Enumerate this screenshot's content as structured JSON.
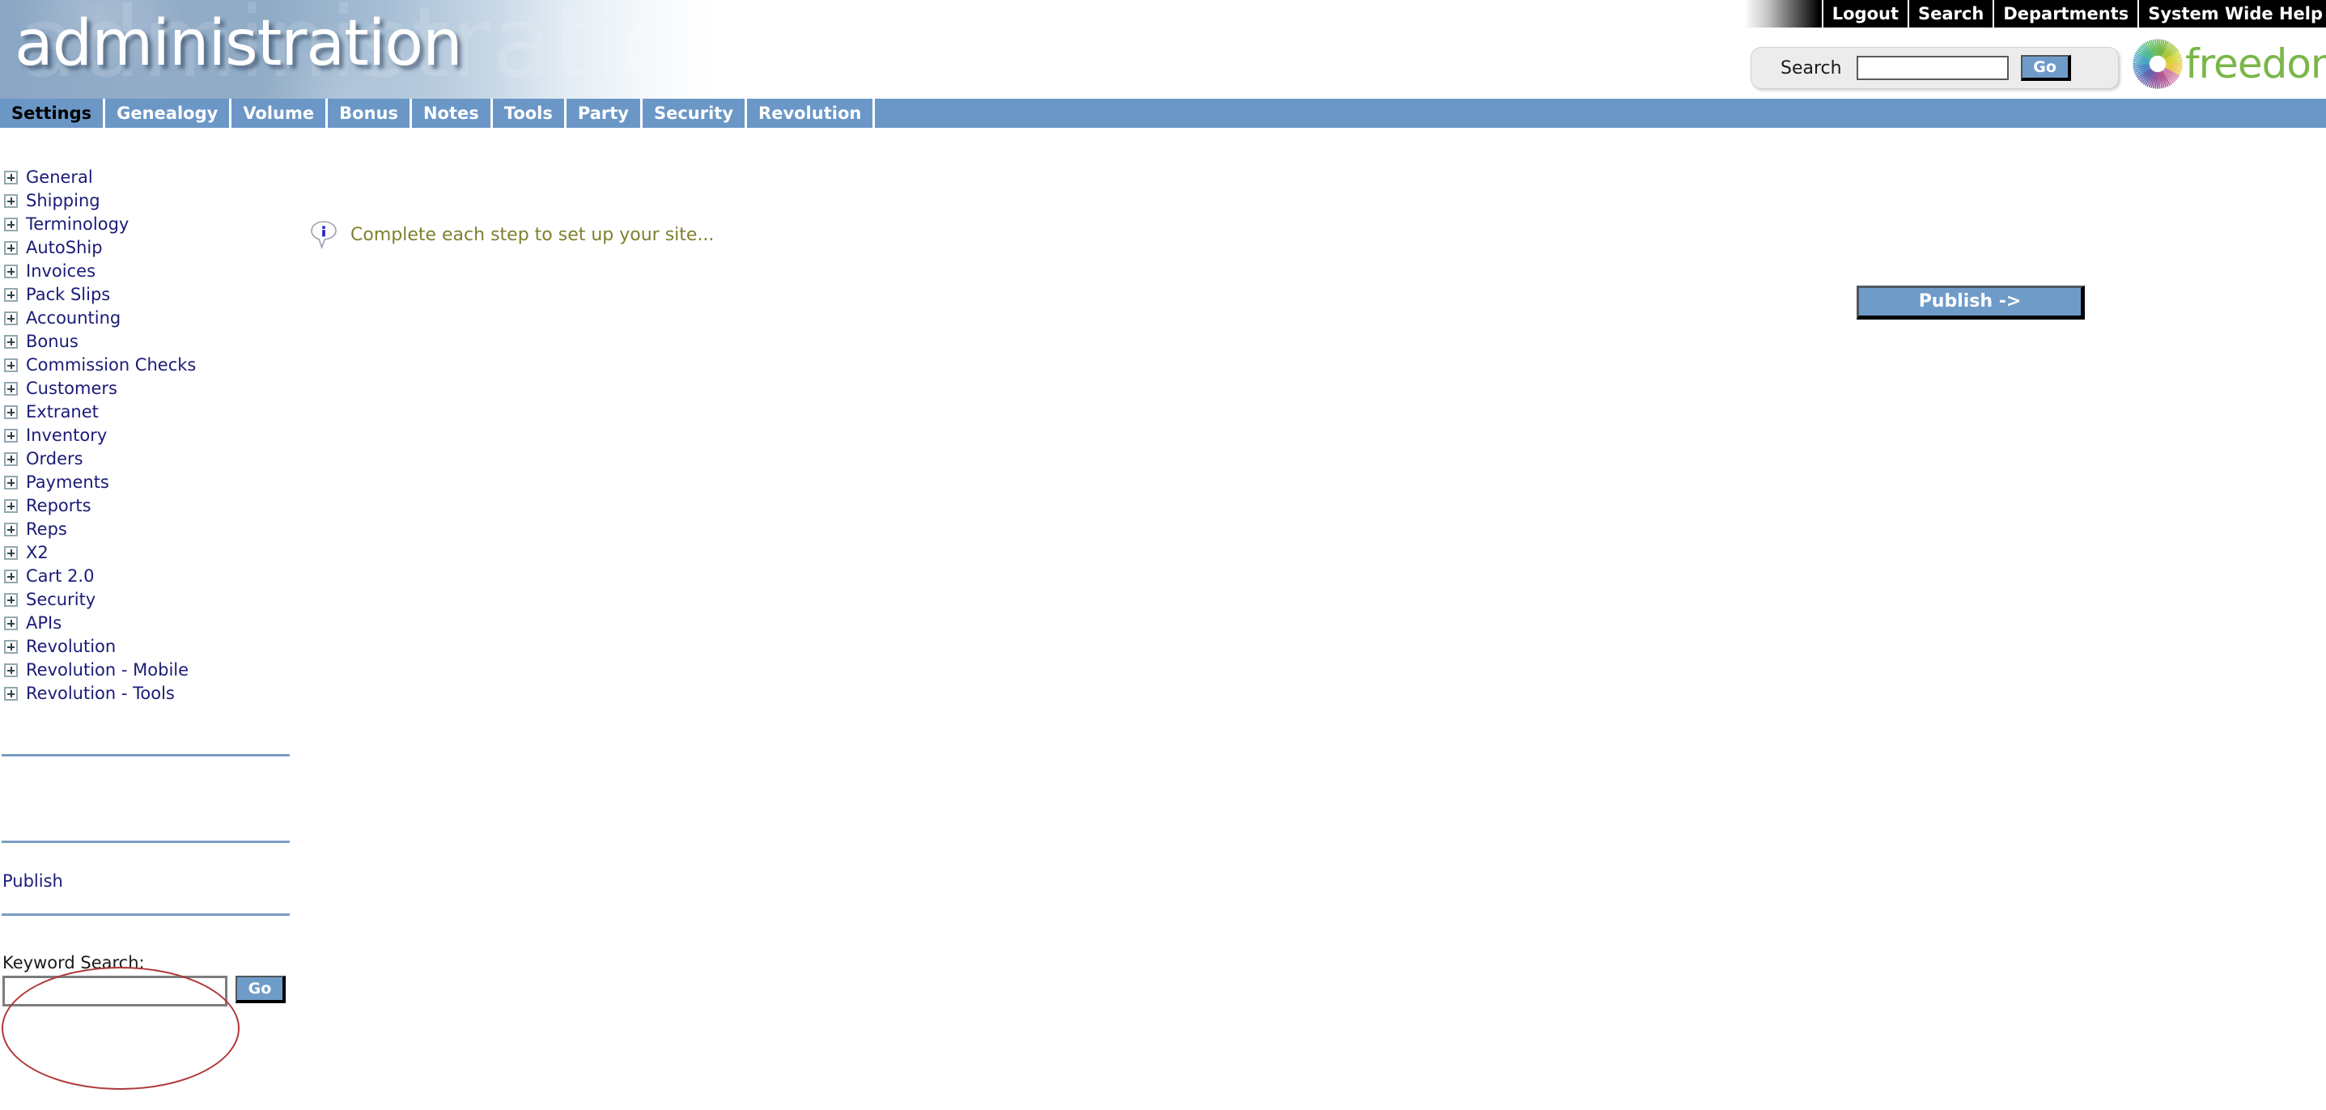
{
  "banner": {
    "title": "administration",
    "ghost_text": "administration"
  },
  "utility_bar": {
    "links": [
      {
        "label": "Logout",
        "name": "logout"
      },
      {
        "label": "Search",
        "name": "search"
      },
      {
        "label": "Departments",
        "name": "departments"
      },
      {
        "label": "System Wide Help",
        "name": "system-wide-help"
      }
    ]
  },
  "header_search": {
    "label": "Search",
    "value": "",
    "placeholder": "",
    "go_label": "Go"
  },
  "logo": {
    "text": "freedom",
    "color": "#7ab648"
  },
  "tabs": [
    {
      "label": "Settings",
      "active": true
    },
    {
      "label": "Genealogy",
      "active": false
    },
    {
      "label": "Volume",
      "active": false
    },
    {
      "label": "Bonus",
      "active": false
    },
    {
      "label": "Notes",
      "active": false
    },
    {
      "label": "Tools",
      "active": false
    },
    {
      "label": "Party",
      "active": false
    },
    {
      "label": "Security",
      "active": false
    },
    {
      "label": "Revolution",
      "active": false
    }
  ],
  "sidebar": {
    "items": [
      {
        "label": "General"
      },
      {
        "label": "Shipping"
      },
      {
        "label": "Terminology"
      },
      {
        "label": "AutoShip"
      },
      {
        "label": "Invoices"
      },
      {
        "label": "Pack Slips"
      },
      {
        "label": "Accounting"
      },
      {
        "label": "Bonus"
      },
      {
        "label": "Commission Checks"
      },
      {
        "label": "Customers"
      },
      {
        "label": "Extranet"
      },
      {
        "label": "Inventory"
      },
      {
        "label": "Orders"
      },
      {
        "label": "Payments"
      },
      {
        "label": "Reports"
      },
      {
        "label": "Reps"
      },
      {
        "label": "X2"
      },
      {
        "label": "Cart 2.0"
      },
      {
        "label": "Security"
      },
      {
        "label": "APIs"
      },
      {
        "label": "Revolution"
      },
      {
        "label": "Revolution - Mobile"
      },
      {
        "label": "Revolution - Tools"
      }
    ],
    "publish_label": "Publish"
  },
  "keyword_search": {
    "label": "Keyword Search:",
    "value": "",
    "placeholder": "",
    "go_label": "Go"
  },
  "main": {
    "notice_text": "Complete each step to set up your site...",
    "notice_icon": "info-balloon-icon",
    "publish_button_label": "Publish ->"
  },
  "colors": {
    "tab_blue": "#6b97c7",
    "link_navy": "#1b1b78",
    "notice_olive": "#7f7f2f",
    "annotation_red": "#b03838",
    "divider_blue": "#7a9dc4"
  }
}
